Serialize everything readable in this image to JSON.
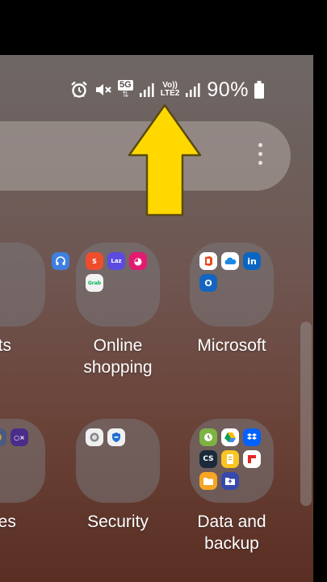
{
  "status_bar": {
    "alarm_icon": "alarm-clock-icon",
    "mute_icon": "vibrate-mute-icon",
    "network_5g": "5G",
    "volte_line1": "Vo))",
    "volte_line2": "LTE2",
    "battery_percent": "90%",
    "battery_icon": "battery-icon"
  },
  "search_bar": {
    "more_icon": "more-options-icon"
  },
  "arrow": {
    "color": "#ffd800"
  },
  "folders": [
    {
      "label": "uts"
    },
    {
      "label_line1": "Online",
      "label_line2": "shopping"
    },
    {
      "label": "Microsoft"
    },
    {
      "label": "mes"
    },
    {
      "label": "Security"
    },
    {
      "label_line1": "Data and",
      "label_line2": "backup"
    }
  ],
  "app_glyphs": {
    "shopee": "S",
    "lazada": "Laz",
    "foodpanda": "◕",
    "grab": "Grab",
    "linkedin": "in",
    "outlook": "O",
    "cs": "CS",
    "galaxy_other": "○×"
  }
}
